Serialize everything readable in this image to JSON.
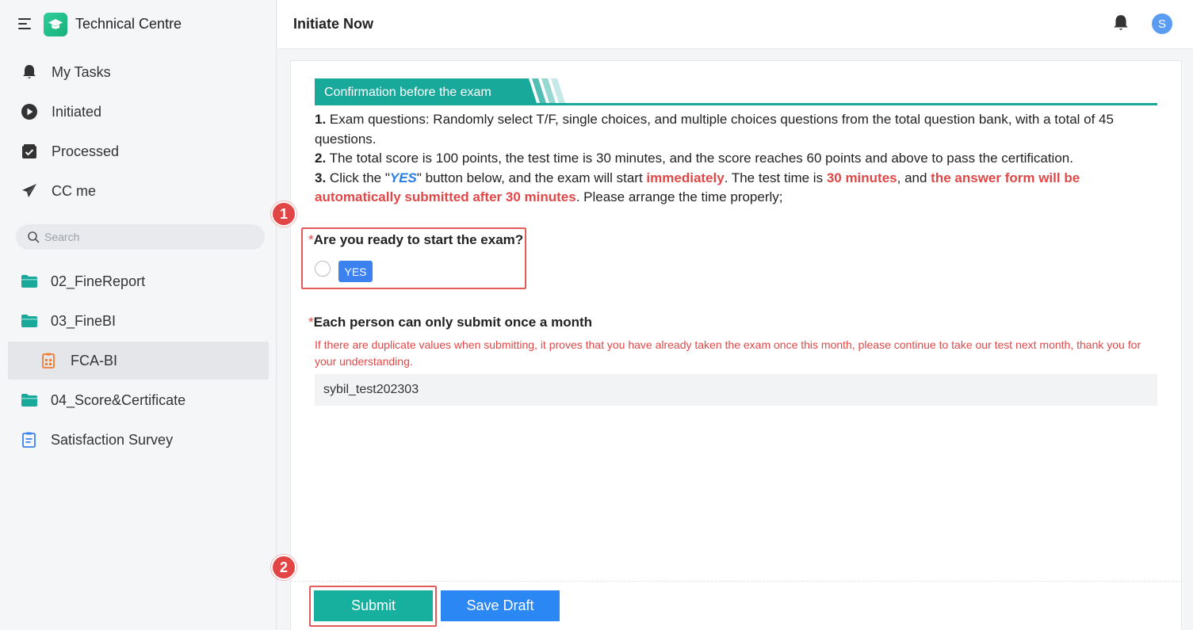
{
  "app": {
    "title": "Technical Centre"
  },
  "nav": {
    "items": [
      {
        "label": "My Tasks",
        "icon": "bell-icon"
      },
      {
        "label": "Initiated",
        "icon": "play-circle-icon"
      },
      {
        "label": "Processed",
        "icon": "check-box-icon"
      },
      {
        "label": "CC me",
        "icon": "paper-plane-icon"
      }
    ]
  },
  "search": {
    "placeholder": "Search"
  },
  "tree": {
    "items": [
      {
        "label": "02_FineReport",
        "icon": "folder-icon"
      },
      {
        "label": "03_FineBI",
        "icon": "folder-icon"
      },
      {
        "label": "FCA-BI",
        "icon": "form-icon"
      },
      {
        "label": "04_Score&Certificate",
        "icon": "folder-icon"
      },
      {
        "label": "Satisfaction Survey",
        "icon": "survey-icon"
      }
    ]
  },
  "header": {
    "title": "Initiate Now",
    "avatar_initial": "S"
  },
  "banner": {
    "title": "Confirmation before the exam"
  },
  "rules": {
    "r1_num": "1.",
    "r1_text": " Exam questions: Randomly select T/F, single choices, and multiple choices questions from the total question bank, with a total of 45 questions.",
    "r2_num": "2.",
    "r2_text": " The total score is 100 points, the test time is 30 minutes, and the score reaches 60 points and above to pass the certification.",
    "r3_num": "3.",
    "r3_a": " Click the \"",
    "r3_yes": "YES",
    "r3_b": "\" button below, and the exam will start ",
    "r3_immediately": "immediately",
    "r3_c": ". The test time is ",
    "r3_minutes": "30 minutes",
    "r3_d": ", and ",
    "r3_auto": "the answer form will be automatically submitted after 30 minutes",
    "r3_e": ". Please arrange the time properly;"
  },
  "q1": {
    "required": "*",
    "label": "Are you ready to start the exam?",
    "option": "YES"
  },
  "q2": {
    "required": "*",
    "label": "Each person can only submit once a month",
    "hint": "If there are duplicate values when submitting, it proves that you have already taken the exam once this month, please continue to take our test next month, thank you for your understanding.",
    "value": "sybil_test202303"
  },
  "actions": {
    "submit": "Submit",
    "save_draft": "Save Draft"
  },
  "annotations": {
    "step1": "1",
    "step2": "2"
  },
  "colors": {
    "accent": "#19a99b",
    "primary": "#2b87f3",
    "danger": "#e04848"
  }
}
